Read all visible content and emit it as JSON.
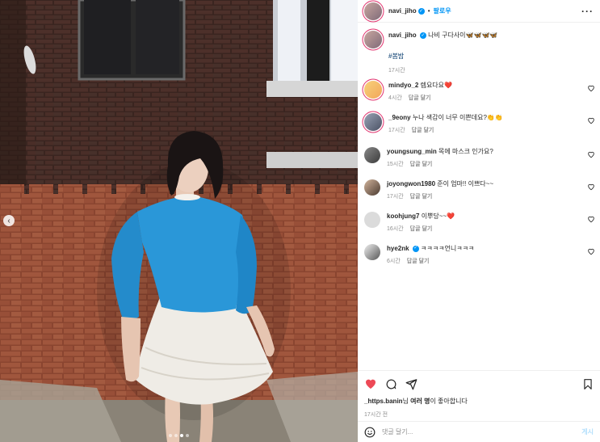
{
  "post": {
    "author": "navi_jiho",
    "follow_label": "팔로우",
    "separator": "•",
    "more_label": "···",
    "caption_text": "나비 구다사이🦋🦋🦋🦋",
    "hashtag": "#봄밤",
    "caption_time": "17시간",
    "likes_user": "_https.banin",
    "likes_suffix": "님 ",
    "likes_rest": "여러 명",
    "likes_end": "이 좋아합니다",
    "timestamp": "17시간 전",
    "carousel": {
      "total": 4,
      "active": 3
    }
  },
  "comments": [
    {
      "user": "mindyo_2",
      "verified": false,
      "text": "렙요다요❤️",
      "time": "4시간",
      "reply": "답글 달기"
    },
    {
      "user": "_9eony",
      "verified": false,
      "text": "누나 색감이 너무 이쁜데요?👏👏",
      "time": "17시간",
      "reply": "답글 달기"
    },
    {
      "user": "youngsung_min",
      "verified": false,
      "text": "목에 마스크 인가요?",
      "time": "15시간",
      "reply": "답글 달기"
    },
    {
      "user": "joyongwon1980",
      "verified": false,
      "text": "준이 엄마!! 이쁘다~~",
      "time": "17시간",
      "reply": "답글 달기"
    },
    {
      "user": "koohjung7",
      "verified": false,
      "text": "이뿌당~~❤️",
      "time": "16시간",
      "reply": "답글 달기"
    },
    {
      "user": "hye2nk",
      "verified": true,
      "text": "ㅋㅋㅋㅋ언니ㅋㅋㅋ",
      "time": "6시간",
      "reply": "답글 달기"
    }
  ],
  "comment_box": {
    "placeholder": "댓글 달기...",
    "post_label": "게시"
  },
  "colors": {
    "accent": "#0095f6",
    "heart": "#ed4956",
    "sweater": "#2a97d8"
  }
}
